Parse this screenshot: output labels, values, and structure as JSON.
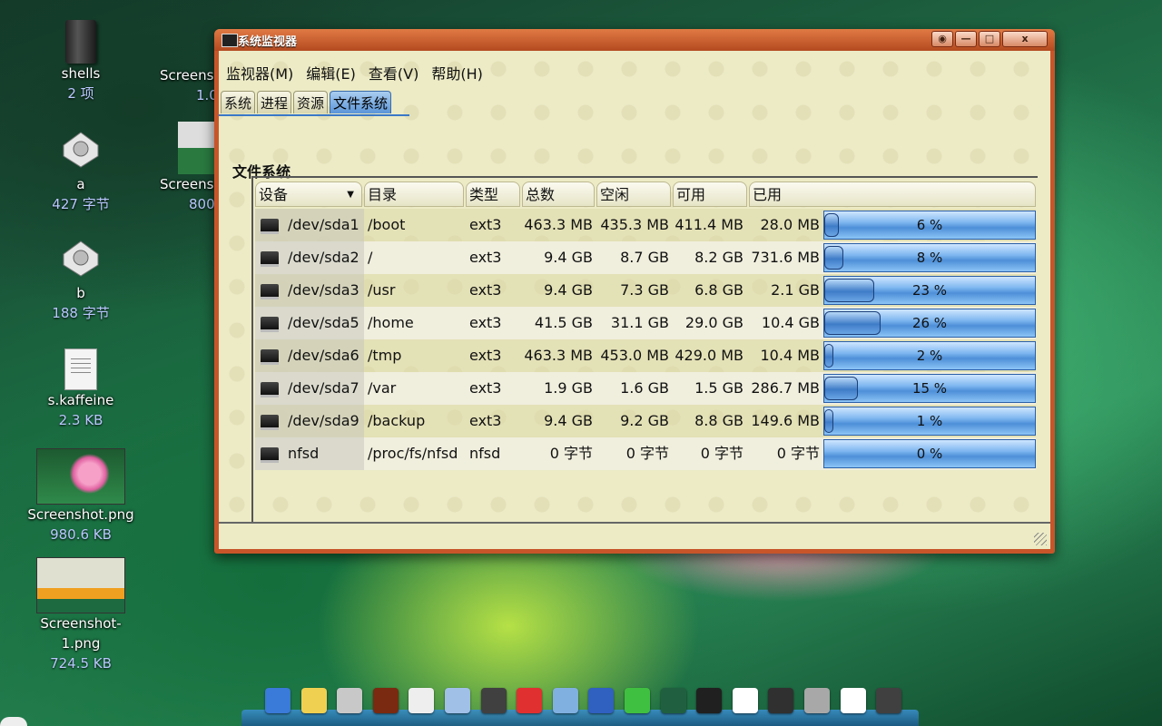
{
  "desktop": {
    "icons": [
      {
        "name": "shells",
        "size": "2 项"
      },
      {
        "name": "a",
        "size": "427 字节"
      },
      {
        "name": "b",
        "size": "188 字节"
      },
      {
        "name": "s.kaffeine",
        "size": "2.3 KB"
      },
      {
        "name": "Screenshot.png",
        "size": "980.6 KB"
      },
      {
        "name": "Screenshot-1.png",
        "size": "724.5 KB"
      }
    ],
    "partial_icons": [
      {
        "name": "Screens",
        "size": "1.0"
      },
      {
        "name": "Screens",
        "size": "800"
      }
    ]
  },
  "window": {
    "title": "系统监视器",
    "buttons": {
      "restore": "◉",
      "minimize": "—",
      "maximize": "□",
      "close": "x"
    },
    "menu": [
      "监视器(M)",
      "编辑(E)",
      "查看(V)",
      "帮助(H)"
    ],
    "tabs": [
      "系统",
      "进程",
      "资源",
      "文件系统"
    ],
    "active_tab": "文件系统",
    "section_title": "文件系统",
    "columns": [
      "设备",
      "目录",
      "类型",
      "总数",
      "空闲",
      "可用",
      "已用"
    ],
    "sort_indicator": "▼",
    "rows": [
      {
        "device": "/dev/sda1",
        "dir": "/boot",
        "type": "ext3",
        "total": "463.3 MB",
        "free": "435.3 MB",
        "avail": "411.4 MB",
        "used": "28.0 MB",
        "pct": 6,
        "pct_label": "6 %"
      },
      {
        "device": "/dev/sda2",
        "dir": "/",
        "type": "ext3",
        "total": "9.4 GB",
        "free": "8.7 GB",
        "avail": "8.2 GB",
        "used": "731.6 MB",
        "pct": 8,
        "pct_label": "8 %"
      },
      {
        "device": "/dev/sda3",
        "dir": "/usr",
        "type": "ext3",
        "total": "9.4 GB",
        "free": "7.3 GB",
        "avail": "6.8 GB",
        "used": "2.1 GB",
        "pct": 23,
        "pct_label": "23 %"
      },
      {
        "device": "/dev/sda5",
        "dir": "/home",
        "type": "ext3",
        "total": "41.5 GB",
        "free": "31.1 GB",
        "avail": "29.0 GB",
        "used": "10.4 GB",
        "pct": 26,
        "pct_label": "26 %"
      },
      {
        "device": "/dev/sda6",
        "dir": "/tmp",
        "type": "ext3",
        "total": "463.3 MB",
        "free": "453.0 MB",
        "avail": "429.0 MB",
        "used": "10.4 MB",
        "pct": 2,
        "pct_label": "2 %"
      },
      {
        "device": "/dev/sda7",
        "dir": "/var",
        "type": "ext3",
        "total": "1.9 GB",
        "free": "1.6 GB",
        "avail": "1.5 GB",
        "used": "286.7 MB",
        "pct": 15,
        "pct_label": "15 %"
      },
      {
        "device": "/dev/sda9",
        "dir": "/backup",
        "type": "ext3",
        "total": "9.4 GB",
        "free": "9.2 GB",
        "avail": "8.8 GB",
        "used": "149.6 MB",
        "pct": 1,
        "pct_label": "1 %"
      },
      {
        "device": "nfsd",
        "dir": "/proc/fs/nfsd",
        "type": "nfsd",
        "total": "0 字节",
        "free": "0 字节",
        "avail": "0 字节",
        "used": "0 字节",
        "pct": 0,
        "pct_label": "0 %"
      }
    ]
  },
  "dock": {
    "items": [
      "system-monitor-icon",
      "notes-icon",
      "speaker-icon",
      "clapper-icon",
      "chat-icon",
      "graphics-icon",
      "browser-icon",
      "qq-penguin-icon",
      "pencil-icon",
      "globe-icon",
      "gem-icon",
      "terminal-icon",
      "book-icon",
      "cpu-icon",
      "screen-icon",
      "settings-icon",
      "calendar-icon",
      "power-icon"
    ],
    "colors": [
      "#3a7ad8",
      "#f0d050",
      "#c8c8c8",
      "#7a2a10",
      "#eeeeee",
      "#a0c0e8",
      "#404040",
      "#e03030",
      "#80b0e0",
      "#3060c0",
      "#40c040",
      "#206040",
      "#202020",
      "#ffffff",
      "#303030",
      "#a8a8a8",
      "#ffffff",
      "#404040"
    ]
  },
  "accent": {
    "tab_active": "#5b95d8",
    "bar": "#4d8fd8",
    "titlebar": "#c8552a"
  }
}
